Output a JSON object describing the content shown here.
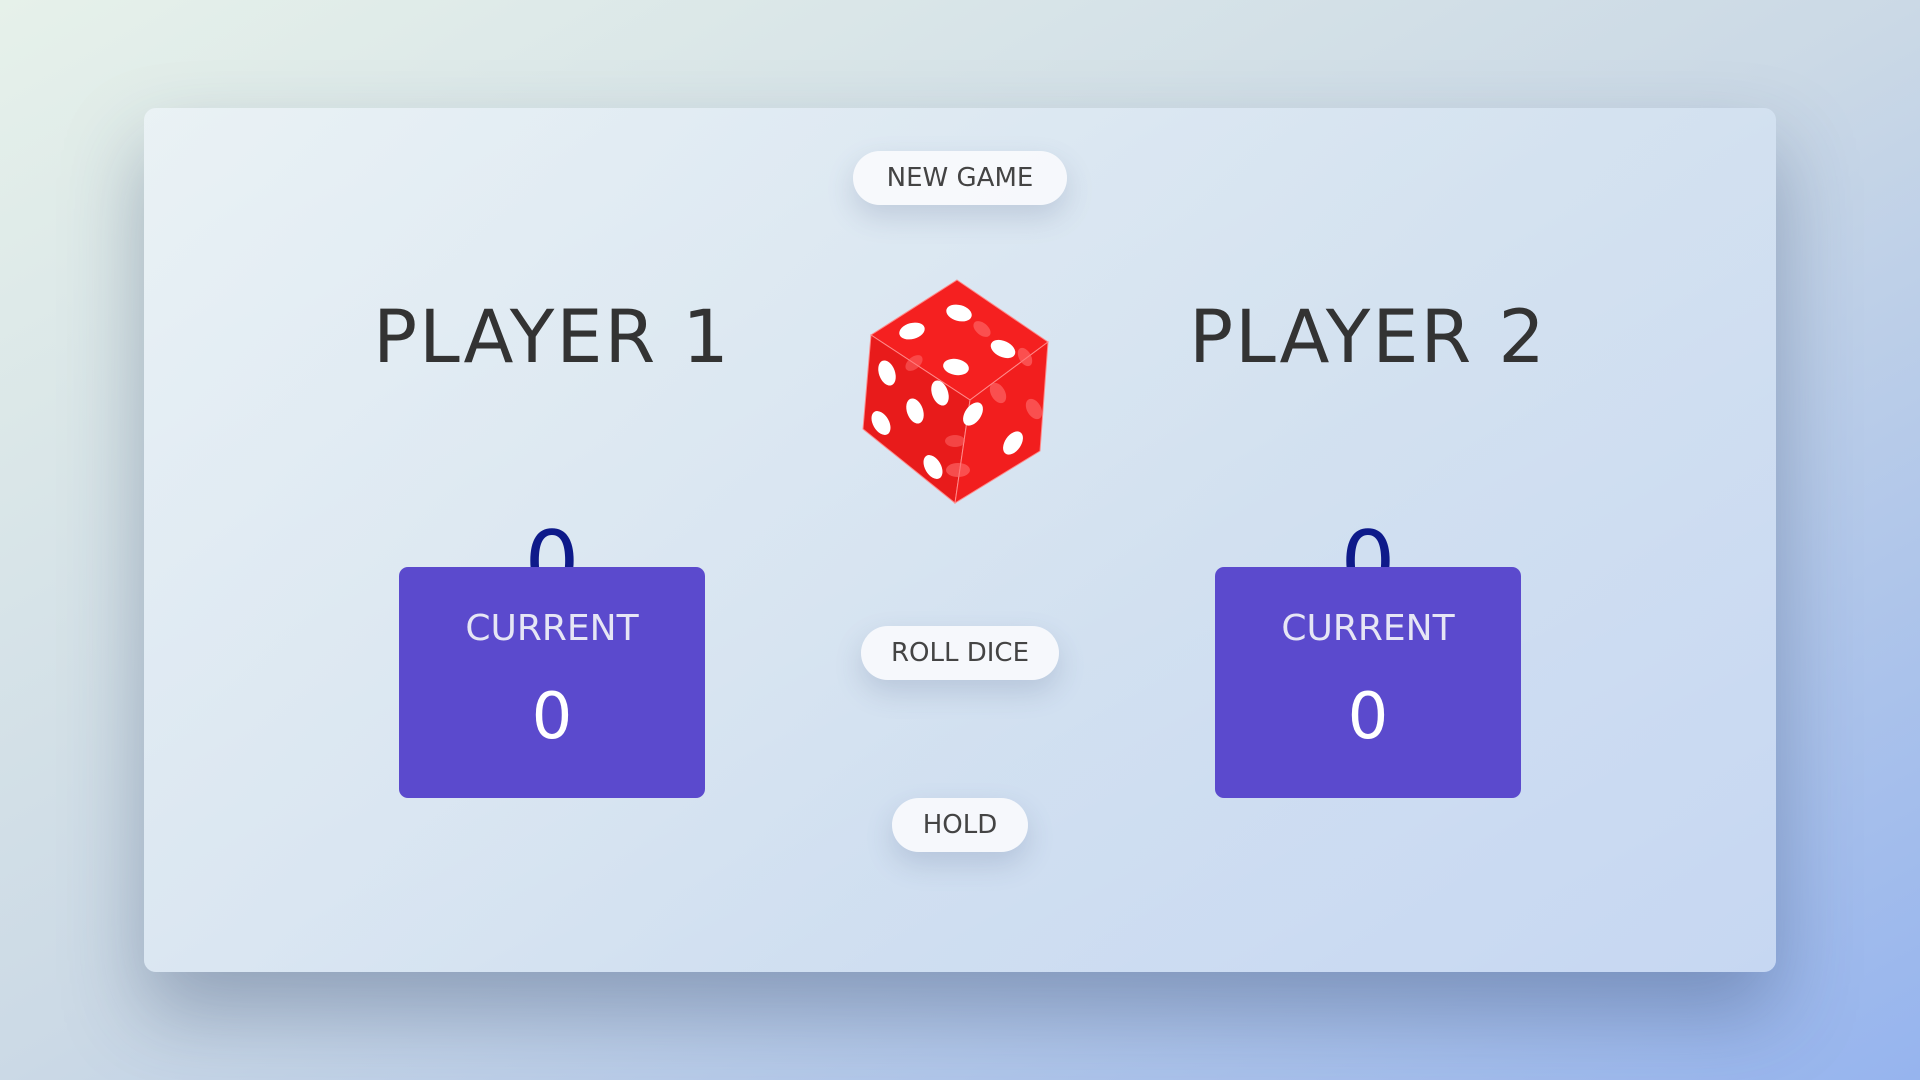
{
  "buttons": {
    "new_game": "NEW GAME",
    "roll_dice": "ROLL DICE",
    "hold": "HOLD"
  },
  "players": [
    {
      "name": "PLAYER 1",
      "score": "0",
      "current_label": "CURRENT",
      "current_score": "0"
    },
    {
      "name": "PLAYER 2",
      "score": "0",
      "current_label": "CURRENT",
      "current_score": "0"
    }
  ],
  "dice": {
    "icon": "dice-icon",
    "color": "#ee1c1c"
  },
  "colors": {
    "current_box": "#5b4acd",
    "score": "#0e1a8a"
  }
}
